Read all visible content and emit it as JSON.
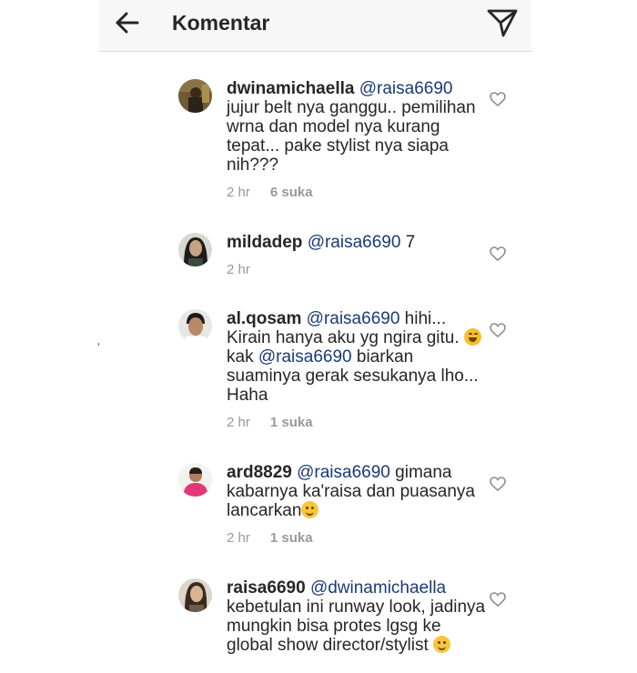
{
  "header": {
    "title": "Komentar"
  },
  "comments": [
    {
      "username": "dwinamichaella",
      "mention": "@raisa6690",
      "text": " jujur belt nya ganggu.. pemilihan wrna dan model nya kurang tepat... pake stylist nya siapa nih???",
      "time": "2 hr",
      "likes": "6 suka"
    },
    {
      "username": "mildadep",
      "mention": "@raisa6690",
      "text": " 7",
      "time": "2 hr",
      "likes": ""
    },
    {
      "username": "al.qosam",
      "mention": "@raisa6690",
      "text": " hihi... Kirain hanya aku yg ngira gitu. ",
      "text2": " kak ",
      "mention2": "@raisa6690",
      "text3": " biarkan suaminya gerak sesukanya lho... Haha",
      "emoji": "laughing-tears-emoji",
      "time": "2 hr",
      "likes": "1 suka"
    },
    {
      "username": "ard8829",
      "mention": "@raisa6690",
      "text": " gimana kabarnya ka'raisa dan puasanya lancarkan",
      "emoji": "smiling-emoji",
      "time": "2 hr",
      "likes": "1 suka"
    },
    {
      "username": "raisa6690",
      "mention": "@dwinamichaella",
      "text": " kebetulan ini runway look, jadinya mungkin bisa protes lgsg ke global show director/stylist",
      "emoji": "smiling-emoji"
    }
  ],
  "colors": {
    "mention": "#1a3a78",
    "meta": "#999999",
    "header_bg": "#f7f7f7"
  }
}
